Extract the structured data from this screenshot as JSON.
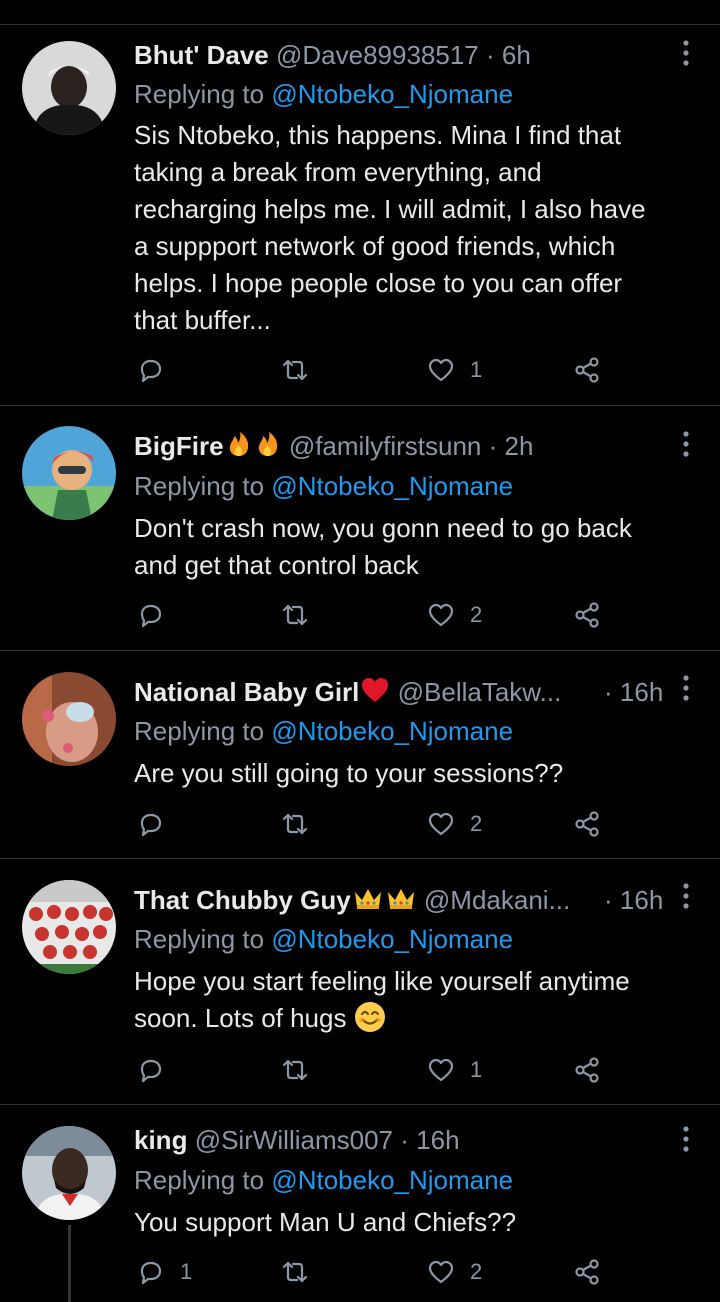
{
  "replying_label": "Replying to",
  "tweets": [
    {
      "name": "Bhut' Dave",
      "handle": "@Dave89938517",
      "time": "6h",
      "mention": "@Ntobeko_Njomane",
      "text": "Sis Ntobeko, this happens. Mina I find that\ntaking a break from everything, and\nrecharging helps me. I will admit, I also have\na suppport network of good friends, which\nhelps. I hope people close to you can offer\nthat buffer...",
      "reply_count": "",
      "retweet_count": "",
      "like_count": "1"
    },
    {
      "name": "BigFire",
      "handle": "@familyfirstsunn",
      "time": "2h",
      "mention": "@Ntobeko_Njomane",
      "text": "Don't crash now, you gonn need to go back\nand get that control back",
      "reply_count": "",
      "retweet_count": "",
      "like_count": "2"
    },
    {
      "name": "National Baby Girl",
      "handle": "@BellaTakw...",
      "time": "16h",
      "mention": "@Ntobeko_Njomane",
      "text": "Are you still going to your sessions??",
      "reply_count": "",
      "retweet_count": "",
      "like_count": "2"
    },
    {
      "name": "That Chubby Guy",
      "handle": "@Mdakani...",
      "time": "16h",
      "mention": "@Ntobeko_Njomane",
      "text": "Hope you start feeling like yourself anytime\nsoon. Lots of hugs",
      "reply_count": "",
      "retweet_count": "",
      "like_count": "1"
    },
    {
      "name": "king",
      "handle": "@SirWilliams007",
      "time": "16h",
      "mention": "@Ntobeko_Njomane",
      "text": "You support Man U and Chiefs??",
      "reply_count": "1",
      "retweet_count": "",
      "like_count": "2"
    }
  ],
  "icons": {
    "reply": "reply-icon",
    "retweet": "retweet-icon",
    "like": "heart-icon",
    "share": "share-icon",
    "more": "more-vertical-icon"
  },
  "colors": {
    "background": "#000000",
    "text": "#e7e9ea",
    "secondary": "#8b98a5",
    "link": "#1d9bf0",
    "divider": "#2f3336"
  }
}
